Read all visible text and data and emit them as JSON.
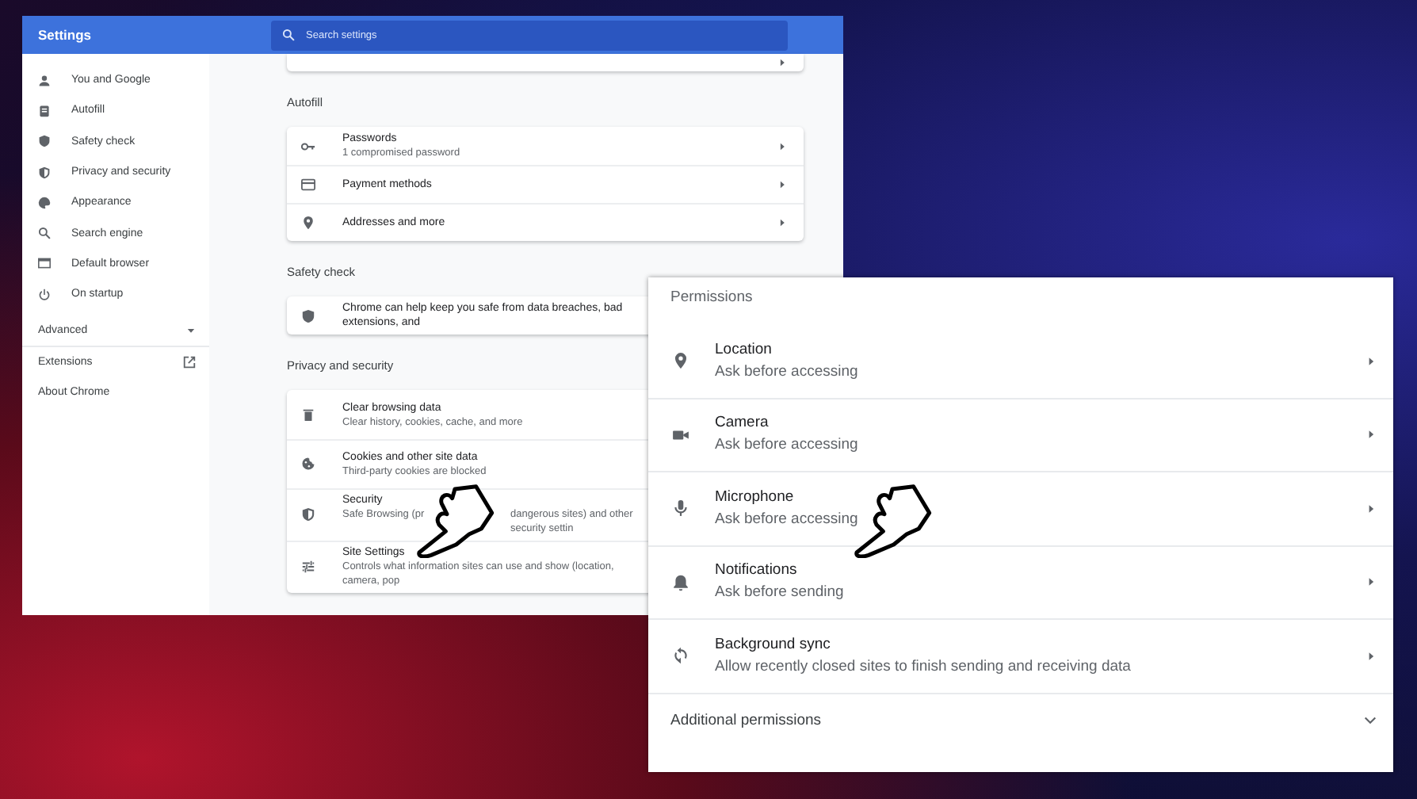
{
  "settings_window": {
    "title": "Settings",
    "search": {
      "placeholder": "Search settings"
    },
    "sidebar": {
      "items": [
        {
          "label": "You and Google",
          "selected": false
        },
        {
          "label": "Autofill",
          "selected": false
        },
        {
          "label": "Safety check",
          "selected": false
        },
        {
          "label": "Privacy and security",
          "selected": false
        },
        {
          "label": "Appearance",
          "selected": false
        },
        {
          "label": "Search engine",
          "selected": false
        },
        {
          "label": "Default browser",
          "selected": false
        },
        {
          "label": "On startup",
          "selected": false
        }
      ],
      "advanced": {
        "label": "Advanced",
        "expanded": false
      },
      "links": [
        {
          "label": "Extensions",
          "external": true
        },
        {
          "label": "About Chrome",
          "external": false
        }
      ]
    },
    "sections": [
      {
        "title": "Autofill",
        "rows": [
          {
            "title": "Passwords",
            "subtitle": "1 compromised password"
          },
          {
            "title": "Payment methods"
          },
          {
            "title": "Addresses and more"
          }
        ]
      },
      {
        "title": "Safety check",
        "rows": [
          {
            "title": "Chrome can help keep you safe from data breaches, bad extensions, and"
          }
        ]
      },
      {
        "title": "Privacy and security",
        "rows": [
          {
            "title": "Clear browsing data",
            "subtitle": "Clear history, cookies, cache, and more"
          },
          {
            "title": "Cookies and other site data",
            "subtitle": "Third-party cookies are blocked"
          },
          {
            "title": "Security",
            "subtitle_parts": [
              "Safe Browsing (pr",
              "dangerous sites) and other security settin"
            ]
          },
          {
            "title": "Site Settings",
            "subtitle": "Controls what information sites can use and show (location, camera, pop"
          }
        ]
      }
    ]
  },
  "permissions_panel": {
    "title": "Permissions",
    "rows": [
      {
        "title": "Location",
        "subtitle": "Ask before accessing"
      },
      {
        "title": "Camera",
        "subtitle": "Ask before accessing"
      },
      {
        "title": "Microphone",
        "subtitle": "Ask before accessing"
      },
      {
        "title": "Notifications",
        "subtitle": "Ask before sending"
      },
      {
        "title": "Background sync",
        "subtitle": "Allow recently closed sites to finish sending and receiving data"
      }
    ],
    "additional": {
      "label": "Additional permissions",
      "expanded": false
    }
  }
}
